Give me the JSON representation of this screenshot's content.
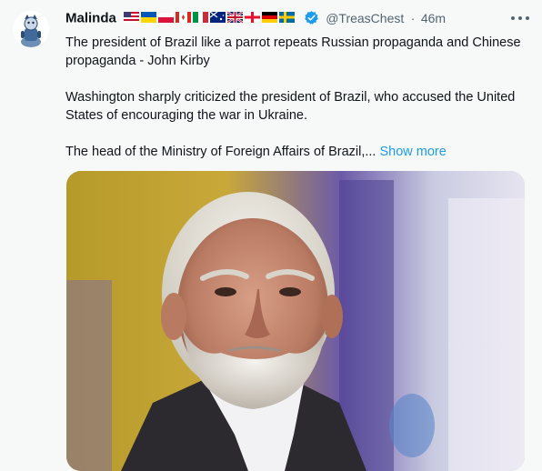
{
  "tweet": {
    "display_name": "Malinda",
    "handle": "@TreasChest",
    "separator": "·",
    "time": "46m",
    "more_icon": "ellipsis-icon",
    "verified_icon": "verified-badge-icon",
    "flags": [
      "US",
      "UA",
      "PL",
      "CA",
      "IT",
      "AU",
      "GB",
      "GE",
      "DE",
      "SE"
    ],
    "paragraph_1": "The president of Brazil like a parrot repeats Russian propaganda and Chinese propaganda - John Kirby",
    "paragraph_2": "Washington sharply criticized the president of Brazil, who accused the United States of encouraging the war in Ukraine.",
    "paragraph_3": "The head of the Ministry of Foreign Affairs of Brazil,...",
    "show_more_label": "Show more"
  },
  "colors": {
    "background": "#f7f9f9",
    "text": "#0f1419",
    "secondary_text": "#536471",
    "link": "#1d9bf0",
    "verified": "#1d9bf0"
  }
}
